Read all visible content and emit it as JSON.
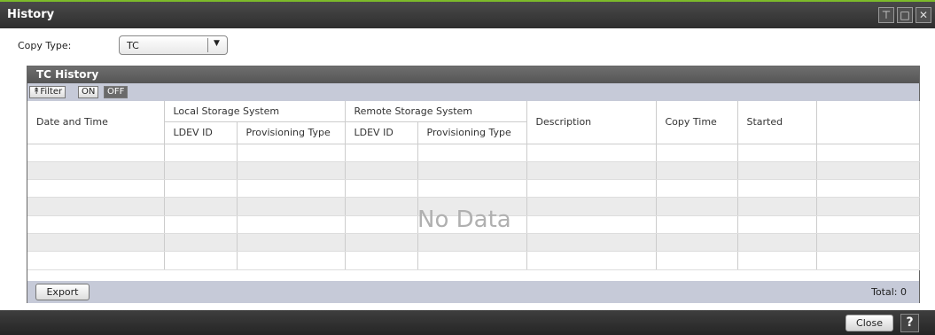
{
  "window": {
    "title": "History",
    "controls": [
      "pin-icon",
      "maximize-icon",
      "close-icon"
    ],
    "accent_color": "#7dbb2a"
  },
  "copy_type": {
    "label": "Copy Type:",
    "selected": "TC"
  },
  "panel": {
    "title": "TC History",
    "filter": {
      "label": "Filter",
      "on_label": "ON",
      "off_label": "OFF",
      "state": "OFF"
    },
    "columns": {
      "date_time": "Date and Time",
      "local_group": "Local Storage System",
      "remote_group": "Remote Storage System",
      "local_ldev": "LDEV ID",
      "local_prov": "Provisioning Type",
      "remote_ldev": "LDEV ID",
      "remote_prov": "Provisioning Type",
      "description": "Description",
      "copy_time": "Copy Time",
      "started": "Started"
    },
    "rows": [],
    "empty_text": "No Data",
    "export_label": "Export",
    "total_text": "Total:  0"
  },
  "footer": {
    "close_label": "Close",
    "help_label": "?"
  }
}
